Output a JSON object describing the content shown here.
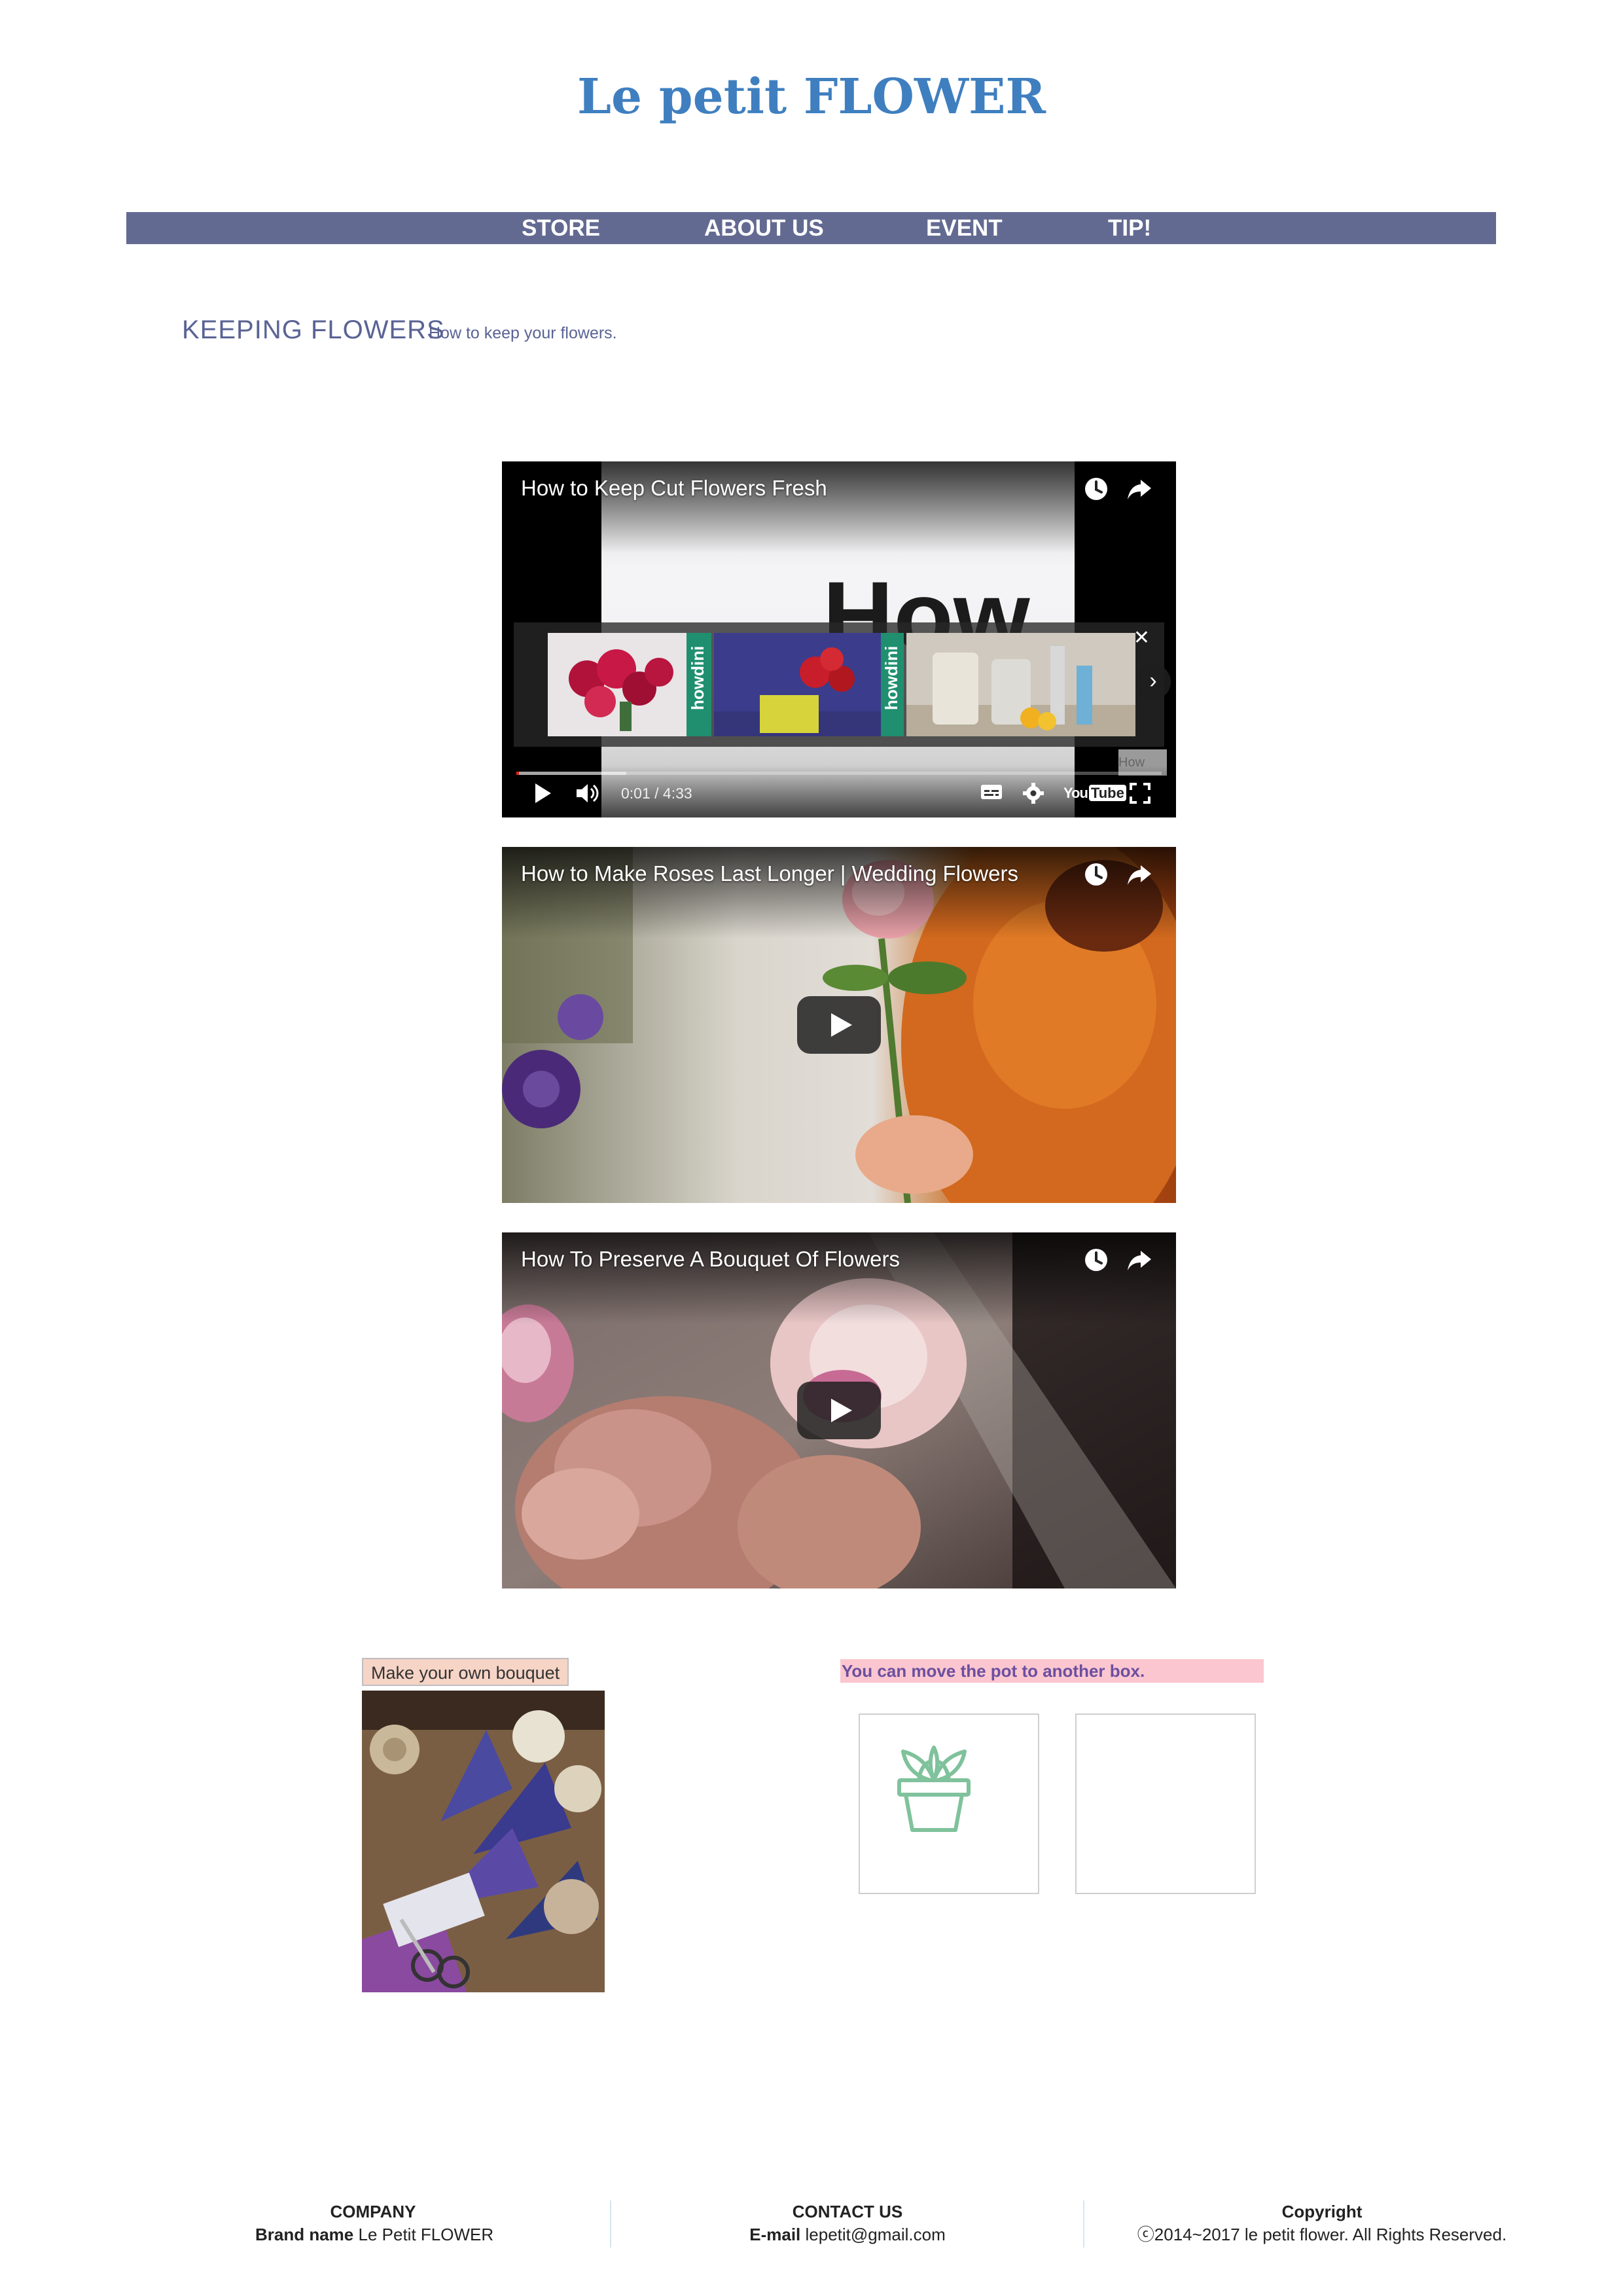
{
  "site": {
    "title": "Le petit FLOWER",
    "brand_color": "#3f7fc0"
  },
  "nav": {
    "bg_color": "#636a92",
    "items": [
      {
        "label": "STORE"
      },
      {
        "label": "ABOUT US"
      },
      {
        "label": "EVENT"
      },
      {
        "label": "TIP!"
      }
    ]
  },
  "section": {
    "title": "KEEPING FLOWERS",
    "subtitle": "How to keep your flowers."
  },
  "videos": [
    {
      "title": "How to Keep Cut Flowers Fresh",
      "big_text": "How",
      "current_time": "0:01",
      "duration": "4:33",
      "time_display": "0:01 / 4:33",
      "progress_fraction": 0.0037,
      "buffered_fraction": 0.17,
      "endscreen_brand": "howdini",
      "endscreen_corner_text": "How",
      "youtube_logo": "YouTube",
      "icons": [
        "watch-later-icon",
        "share-icon",
        "play-icon",
        "volume-icon",
        "captions-icon",
        "settings-icon",
        "youtube-logo",
        "fullscreen-icon",
        "close-icon",
        "chevron-right-icon"
      ]
    },
    {
      "title": "How to Make Roses Last Longer | Wedding Flowers",
      "icons": [
        "watch-later-icon",
        "share-icon",
        "play-icon"
      ]
    },
    {
      "title": "How To Preserve A Bouquet Of Flowers",
      "icons": [
        "watch-later-icon",
        "share-icon",
        "play-icon"
      ]
    }
  ],
  "bouquet": {
    "label": "Make your own bouquet",
    "label_bg": "#f6d4c6"
  },
  "pot_game": {
    "hint": "You can move the pot to another box.",
    "hint_bg": "#fbc6cf",
    "boxes": [
      {
        "contains": "plant-pot-icon"
      },
      {
        "contains": ""
      }
    ],
    "pot_color": "#7fc29b"
  },
  "footer": {
    "company": {
      "heading": "COMPANY",
      "label": "Brand name",
      "value": "Le Petit FLOWER"
    },
    "contact": {
      "heading": "CONTACT US",
      "label": "E-mail",
      "value": "lepetit@gmail.com"
    },
    "copyright": {
      "heading": "Copyright",
      "text": "ⓒ2014~2017 le petit flower. All Rights Reserved."
    }
  }
}
